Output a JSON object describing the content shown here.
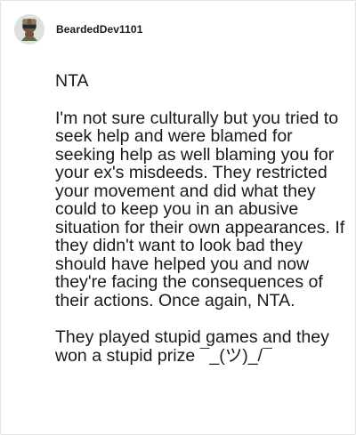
{
  "post": {
    "author": "BeardedDev1101",
    "avatar_icon": "avatar-icon",
    "paragraphs": [
      "NTA",
      "I'm not sure culturally but you tried to seek help and were blamed for seeking help as well blaming you for your ex's misdeeds. They restricted your movement and did what they could to keep you in an abusive situation for their own appearances. If they didn't want to look bad they should have helped you and now they're facing the consequences of their actions. Once again, NTA.",
      "They played stupid games and they won a stupid prize ¯_(ツ)_/¯"
    ]
  }
}
